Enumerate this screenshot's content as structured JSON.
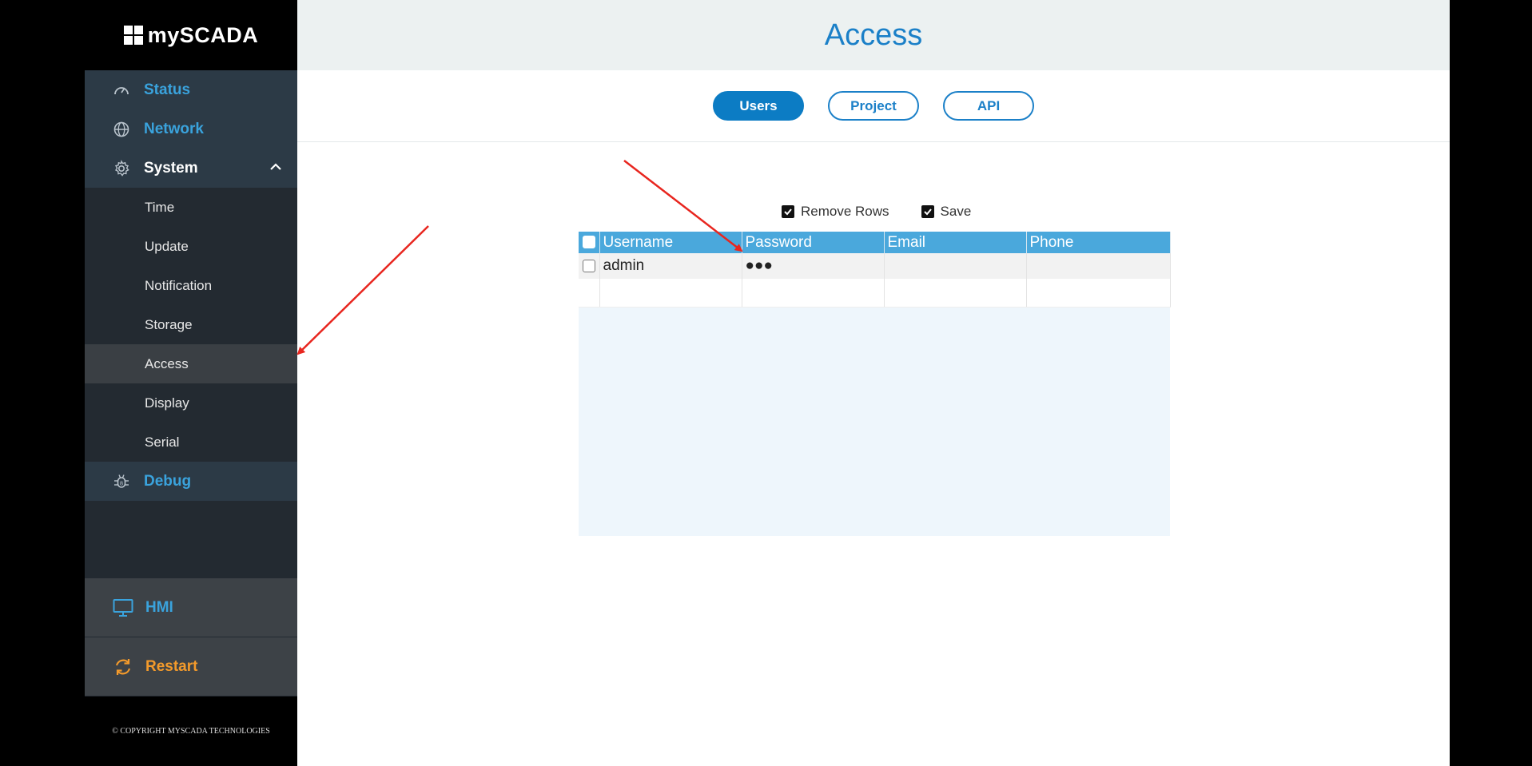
{
  "brand": {
    "name": "mySCADA"
  },
  "sidebar": {
    "top": [
      {
        "label": "Status",
        "icon": "gauge-icon"
      },
      {
        "label": "Network",
        "icon": "globe-icon"
      },
      {
        "label": "System",
        "icon": "gear-icon",
        "expanded": true
      }
    ],
    "submenu": [
      "Time",
      "Update",
      "Notification",
      "Storage",
      "Access",
      "Display",
      "Serial"
    ],
    "active_sub": "Access",
    "debug": {
      "label": "Debug",
      "icon": "bug-icon"
    },
    "hmi": {
      "label": "HMI",
      "icon": "monitor-icon"
    },
    "restart": {
      "label": "Restart",
      "icon": "refresh-icon"
    },
    "copyright": "© COPYRIGHT MYSCADA TECHNOLOGIES"
  },
  "page": {
    "title": "Access"
  },
  "tabs": [
    {
      "label": "Users",
      "active": true
    },
    {
      "label": "Project",
      "active": false
    },
    {
      "label": "API",
      "active": false
    }
  ],
  "toolbar": {
    "remove_rows": "Remove Rows",
    "save": "Save"
  },
  "table": {
    "columns": [
      "Username",
      "Password",
      "Email",
      "Phone"
    ],
    "rows": [
      {
        "username": "admin",
        "password": "●●●",
        "email": "",
        "phone": ""
      }
    ]
  },
  "colors": {
    "accent": "#1b80c8",
    "restart": "#f39a2b",
    "header_bg": "#4aa8dc",
    "annotation": "#e8261f"
  }
}
